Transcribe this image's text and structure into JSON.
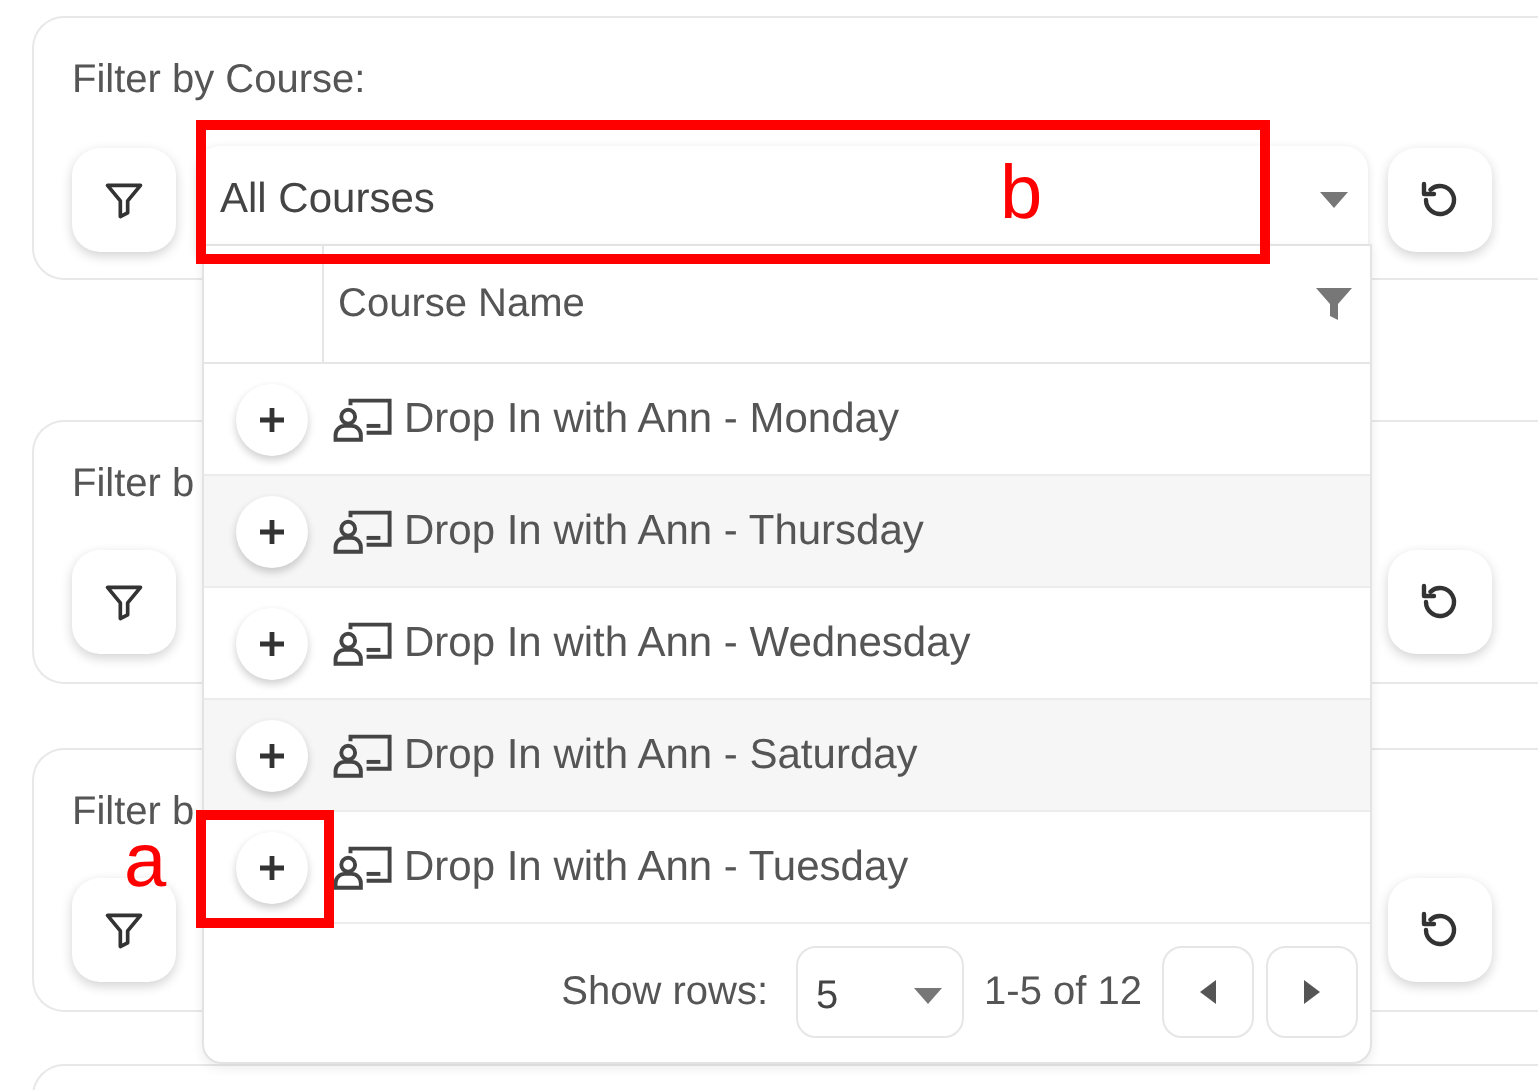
{
  "filters": [
    {
      "label": "Filter by Course:",
      "value": "All Courses"
    },
    {
      "label": "Filter b"
    },
    {
      "label": "Filter b"
    }
  ],
  "dropdown": {
    "columns": [
      "Course Name"
    ],
    "rows": [
      {
        "name": "Drop In with Ann - Monday"
      },
      {
        "name": "Drop In with Ann - Thursday"
      },
      {
        "name": "Drop In with Ann - Wednesday"
      },
      {
        "name": "Drop In with Ann - Saturday"
      },
      {
        "name": "Drop In with Ann - Tuesday"
      }
    ],
    "pagination": {
      "label": "Show rows:",
      "rows_per_page": "5",
      "range": "1-5 of 12"
    }
  },
  "annotations": [
    {
      "label": "b"
    },
    {
      "label": "a"
    }
  ]
}
